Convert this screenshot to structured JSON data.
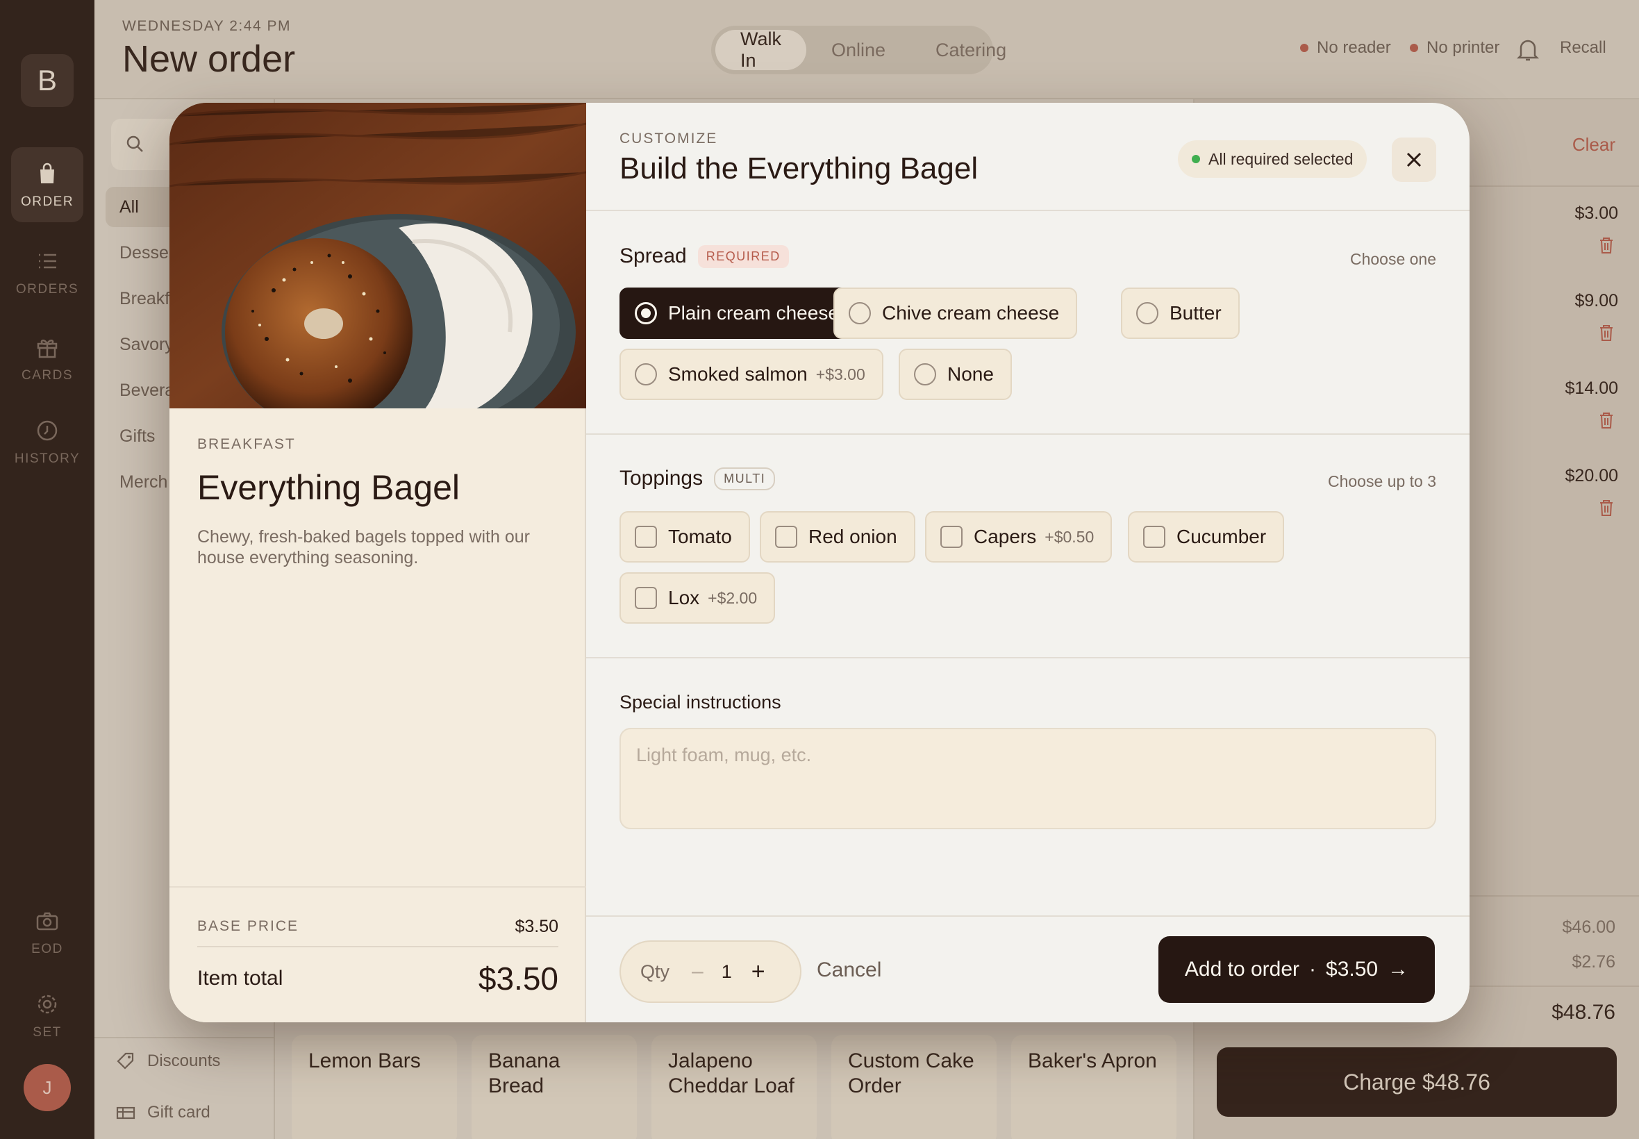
{
  "rail": {
    "logo": "B",
    "items": [
      {
        "label": "ORDER",
        "icon": "bag-icon"
      },
      {
        "label": "ORDERS",
        "icon": "list-icon"
      },
      {
        "label": "CARDS",
        "icon": "gift-icon"
      },
      {
        "label": "HISTORY",
        "icon": "clock-icon"
      },
      {
        "label": "EOD",
        "icon": "camera-icon"
      },
      {
        "label": "SET",
        "icon": "gear-icon"
      }
    ],
    "avatar": "J"
  },
  "header": {
    "date": "WEDNESDAY 2:44 PM",
    "title": "New order",
    "tabs": [
      "Walk In",
      "Online",
      "Catering"
    ],
    "active_tab": "Walk In",
    "reader": "No reader",
    "printer": "No printer",
    "recall": "Recall"
  },
  "sidebar": {
    "search_placeholder": "Search",
    "categories": [
      "All",
      "Desserts",
      "Breakfast",
      "Savory",
      "Beverages",
      "Gifts",
      "Merch"
    ],
    "active": "All",
    "discounts": "Discounts",
    "gift_card": "Gift card"
  },
  "tiles": [
    "Lemon Bars",
    "Banana Bread",
    "Jalapeno Cheddar Loaf",
    "Custom Cake Order",
    "Baker's Apron"
  ],
  "cart": {
    "clear": "Clear",
    "lines": [
      "$3.00",
      "$9.00",
      "$14.00",
      "$20.00"
    ],
    "subtotal": "$46.00",
    "tax": "$2.76",
    "total": "$48.76",
    "charge": "Charge $48.76"
  },
  "modal": {
    "category": "BREAKFAST",
    "name": "Everything Bagel",
    "description": "Chewy, fresh-baked bagels topped with our house everything seasoning.",
    "base_price_label": "BASE PRICE",
    "base_price": "$3.50",
    "item_total_label": "Item total",
    "item_total": "$3.50",
    "eyebrow": "CUSTOMIZE",
    "title": "Build the Everything Bagel",
    "status": "All required selected",
    "spread": {
      "label": "Spread",
      "badge": "REQUIRED",
      "hint": "Choose one",
      "options": [
        {
          "name": "Plain cream cheese",
          "extra": "",
          "selected": true
        },
        {
          "name": "Chive cream cheese",
          "extra": ""
        },
        {
          "name": "Butter",
          "extra": ""
        },
        {
          "name": "Smoked salmon",
          "extra": "+$3.00"
        },
        {
          "name": "None",
          "extra": ""
        }
      ]
    },
    "toppings": {
      "label": "Toppings",
      "badge": "MULTI",
      "hint": "Choose up to 3",
      "options": [
        {
          "name": "Tomato",
          "extra": ""
        },
        {
          "name": "Red onion",
          "extra": ""
        },
        {
          "name": "Capers",
          "extra": "+$0.50"
        },
        {
          "name": "Cucumber",
          "extra": ""
        },
        {
          "name": "Lox",
          "extra": "+$2.00"
        }
      ]
    },
    "special": {
      "label": "Special instructions",
      "placeholder": "Light foam, mug, etc."
    },
    "qty_label": "Qty",
    "qty_minus": "–",
    "qty": "1",
    "qty_plus": "+",
    "cancel": "Cancel",
    "add_label": "Add to order",
    "add_sep": "·",
    "add_price": "$3.50",
    "add_arrow": "→"
  }
}
